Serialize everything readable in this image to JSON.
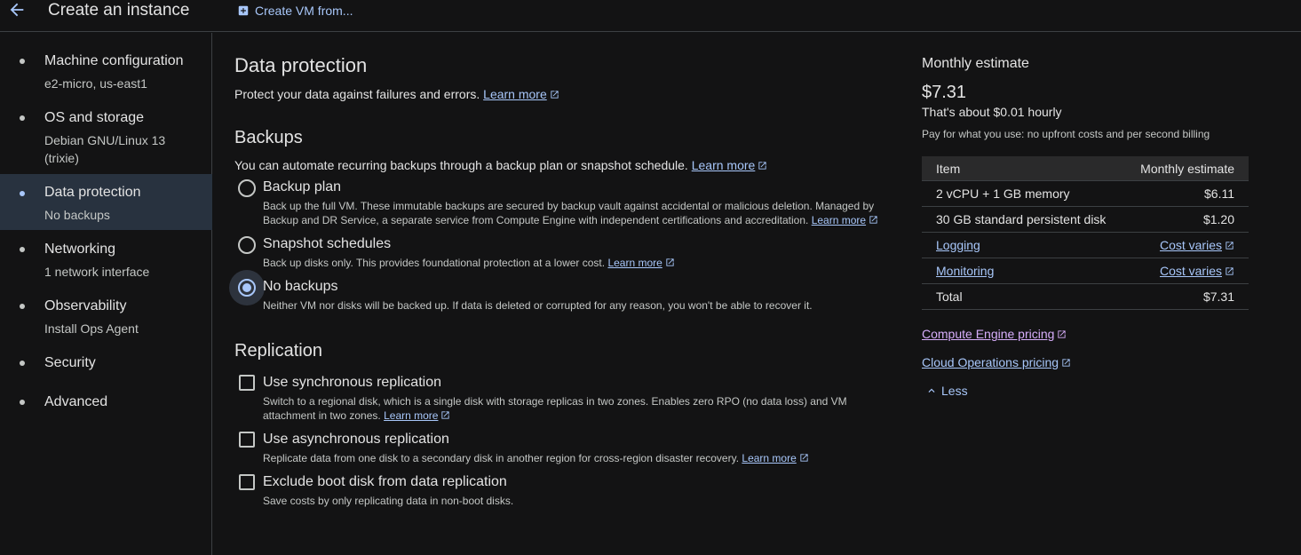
{
  "header": {
    "title": "Create an instance",
    "create_from": "Create VM from..."
  },
  "sidebar": {
    "items": [
      {
        "label": "Machine configuration",
        "sub": "e2-micro, us-east1"
      },
      {
        "label": "OS and storage",
        "sub": "Debian GNU/Linux 13 (trixie)"
      },
      {
        "label": "Data protection",
        "sub": "No backups"
      },
      {
        "label": "Networking",
        "sub": "1 network interface"
      },
      {
        "label": "Observability",
        "sub": "Install Ops Agent"
      },
      {
        "label": "Security",
        "sub": ""
      },
      {
        "label": "Advanced",
        "sub": ""
      }
    ]
  },
  "main": {
    "title": "Data protection",
    "intro": "Protect your data against failures and errors.",
    "learn_more": "Learn more",
    "backups": {
      "title": "Backups",
      "intro": "You can automate recurring backups through a backup plan or snapshot schedule.",
      "options": [
        {
          "title": "Backup plan",
          "desc": "Back up the full VM. These immutable backups are secured by backup vault against accidental or malicious deletion. Managed by Backup and DR Service, a separate service from Compute Engine with independent certifications and accreditation.",
          "selected": false
        },
        {
          "title": "Snapshot schedules",
          "desc": "Back up disks only. This provides foundational protection at a lower cost.",
          "selected": false
        },
        {
          "title": "No backups",
          "desc": "Neither VM nor disks will be backed up. If data is deleted or corrupted for any reason, you won't be able to recover it.",
          "selected": true
        }
      ]
    },
    "replication": {
      "title": "Replication",
      "options": [
        {
          "title": "Use synchronous replication",
          "desc": "Switch to a regional disk, which is a single disk with storage replicas in two zones. Enables zero RPO (no data loss) and VM attachment in two zones.",
          "checked": false
        },
        {
          "title": "Use asynchronous replication",
          "desc": "Replicate data from one disk to a secondary disk in another region for cross-region disaster recovery.",
          "checked": false
        },
        {
          "title": "Exclude boot disk from data replication",
          "desc": "Save costs by only replicating data in non-boot disks.",
          "checked": false
        }
      ]
    }
  },
  "estimate": {
    "title": "Monthly estimate",
    "price": "$7.31",
    "hourly": "That's about $0.01 hourly",
    "note": "Pay for what you use: no upfront costs and per second billing",
    "table": {
      "headers": [
        "Item",
        "Monthly estimate"
      ],
      "rows": [
        {
          "item": "2 vCPU + 1 GB memory",
          "cost": "$6.11"
        },
        {
          "item": "30 GB standard persistent disk",
          "cost": "$1.20"
        },
        {
          "item": "Logging",
          "cost": "Cost varies"
        },
        {
          "item": "Monitoring",
          "cost": "Cost varies"
        },
        {
          "item": "Total",
          "cost": "$7.31"
        }
      ]
    },
    "links": [
      "Compute Engine pricing",
      "Cloud Operations pricing"
    ],
    "less": "Less"
  },
  "colors": {
    "background": "#131314",
    "accent": "#a8c7fa",
    "active_nav": "#28323f",
    "visited_link": "#d7aefb"
  }
}
